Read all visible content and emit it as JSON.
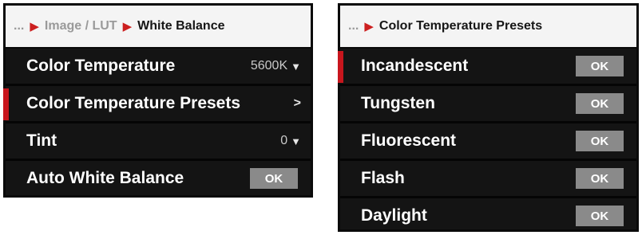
{
  "left_menu": {
    "breadcrumb": {
      "prefix": "...",
      "parent": "Image / LUT",
      "current": "White Balance"
    },
    "items": [
      {
        "label": "Color Temperature",
        "value": "5600K",
        "indicator": "dropdown"
      },
      {
        "label": "Color Temperature Presets",
        "value": "",
        "indicator": "submenu",
        "selected": true
      },
      {
        "label": "Tint",
        "value": "0",
        "indicator": "dropdown"
      },
      {
        "label": "Auto White Balance",
        "button": "OK"
      }
    ]
  },
  "right_menu": {
    "breadcrumb": {
      "prefix": "...",
      "current": "Color Temperature Presets"
    },
    "items": [
      {
        "label": "Incandescent",
        "button": "OK",
        "selected": true
      },
      {
        "label": "Tungsten",
        "button": "OK"
      },
      {
        "label": "Fluorescent",
        "button": "OK"
      },
      {
        "label": "Flash",
        "button": "OK"
      },
      {
        "label": "Daylight",
        "button": "OK"
      }
    ]
  },
  "icons": {
    "separator": "chevron-right-icon",
    "dropdown": "triangle-down-icon",
    "submenu": "chevron-right-icon"
  },
  "colors": {
    "accent": "#c8161d",
    "panel": "#141414",
    "breadcrumb_bg": "#f4f4f4",
    "ok_button": "#8a8a8a"
  }
}
